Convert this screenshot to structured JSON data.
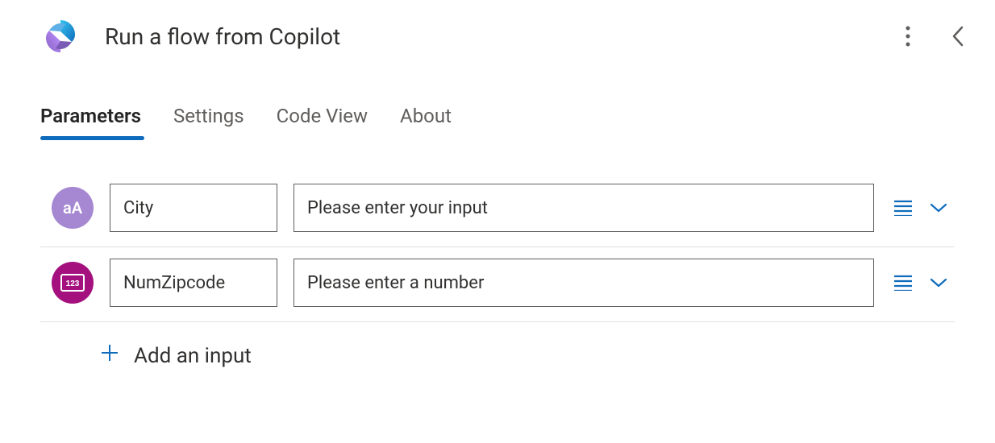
{
  "header": {
    "title": "Run a flow from Copilot"
  },
  "tabs": [
    {
      "label": "Parameters",
      "active": true
    },
    {
      "label": "Settings",
      "active": false
    },
    {
      "label": "Code View",
      "active": false
    },
    {
      "label": "About",
      "active": false
    }
  ],
  "params": [
    {
      "type": "text",
      "type_icon_label": "aA",
      "name": "City",
      "value": "",
      "placeholder": "Please enter your input"
    },
    {
      "type": "number",
      "type_icon_label": "123",
      "name": "NumZipcode",
      "value": "",
      "placeholder": "Please enter a number"
    }
  ],
  "add_input": {
    "label": "Add an input"
  }
}
